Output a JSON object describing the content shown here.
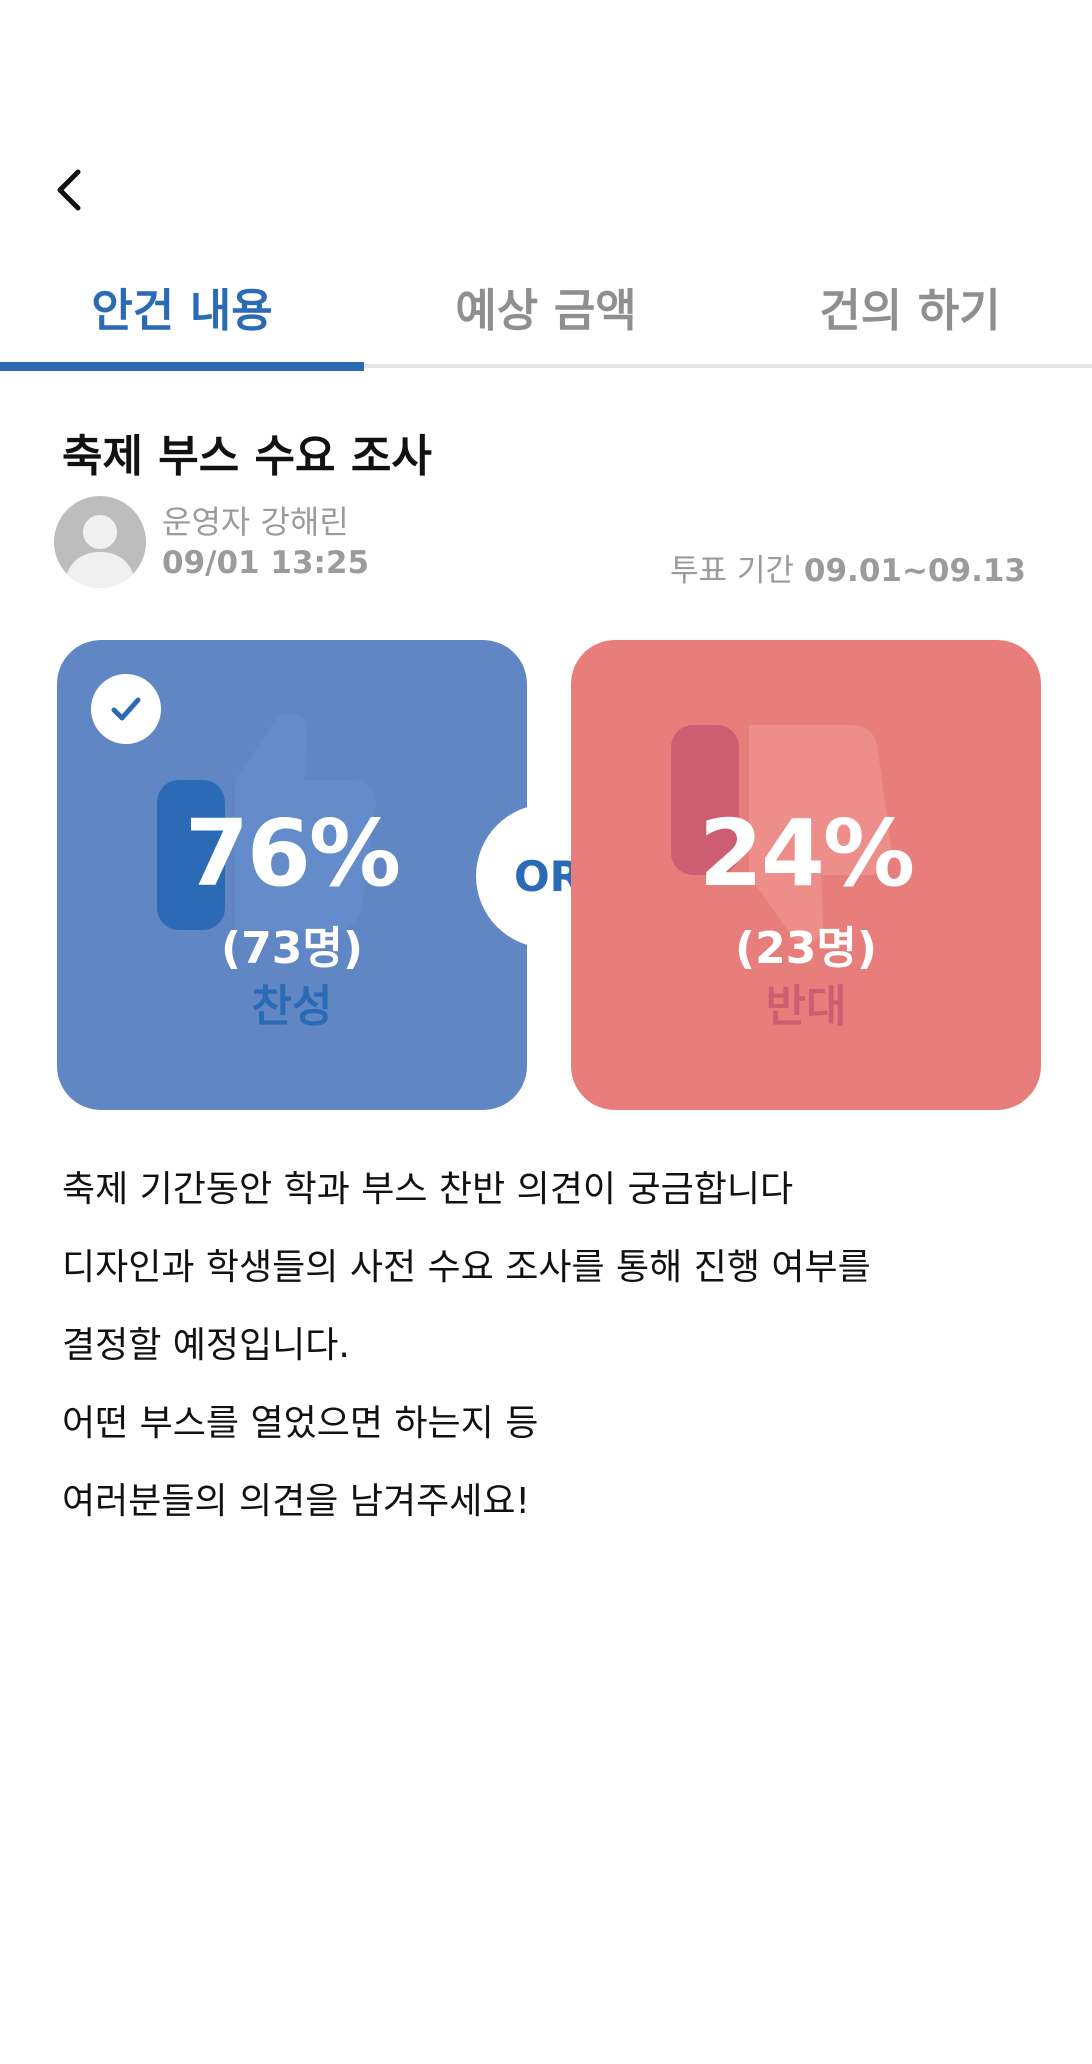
{
  "header": {
    "back_icon": "chevron-left-icon"
  },
  "tabs": [
    {
      "label": "안건 내용",
      "active": true
    },
    {
      "label": "예상 금액",
      "active": false
    },
    {
      "label": "건의 하기",
      "active": false
    }
  ],
  "post": {
    "title": "축제 부스 수요 조사",
    "author": "운영자 강해린",
    "datetime": "09/01 13:25",
    "period_label": "투표 기간",
    "period_range": "09.01~09.13"
  },
  "vote": {
    "agree": {
      "percent": "76%",
      "count": "(73명)",
      "label": "찬성",
      "selected": true,
      "icon": "thumbs-up-icon"
    },
    "or_label": "OR",
    "disagree": {
      "percent": "24%",
      "count": "(23명)",
      "label": "반대",
      "selected": false,
      "icon": "thumbs-down-icon"
    }
  },
  "body_lines": [
    "축제 기간동안 학과 부스 찬반 의견이 궁금합니다",
    "디자인과 학생들의 사전 수요 조사를 통해 진행 여부를",
    "결정할 예정입니다.",
    "어떤 부스를 열었으면 하는지 등",
    "여러분들의 의견을 남겨주세요!"
  ],
  "colors": {
    "accent": "#2b6bb6",
    "agree_card": "#6087c4",
    "disagree_card": "#e87e7b",
    "disagree_label": "#cd5e72"
  }
}
